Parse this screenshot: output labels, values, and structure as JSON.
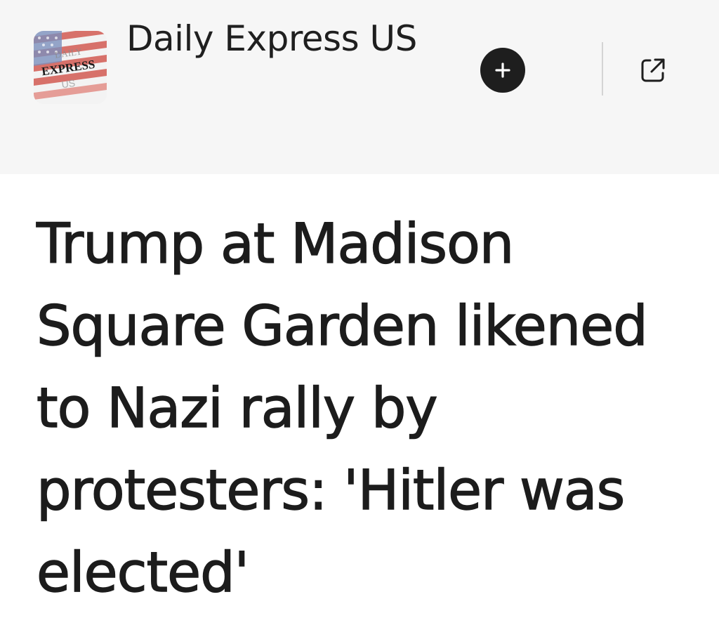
{
  "publisher": {
    "name": "Daily Express US",
    "logo": {
      "icon": "daily-express-us-logo",
      "text": "DAILY EXPRESS US",
      "colors": {
        "stripe_red": "#c8453e",
        "canton_blue": "#6f86b8",
        "text": "#1a1a1a"
      }
    }
  },
  "actions": {
    "follow": {
      "icon": "plus-icon"
    },
    "share": {
      "icon": "external-link-icon"
    }
  },
  "article": {
    "headline": "Trump at Madison Square Garden likened to Nazi rally by protesters: 'Hitler was elected'"
  },
  "colors": {
    "header_background": "#f6f6f6",
    "text_primary": "#1c1c1c",
    "follow_button": "#1e1e1e"
  }
}
